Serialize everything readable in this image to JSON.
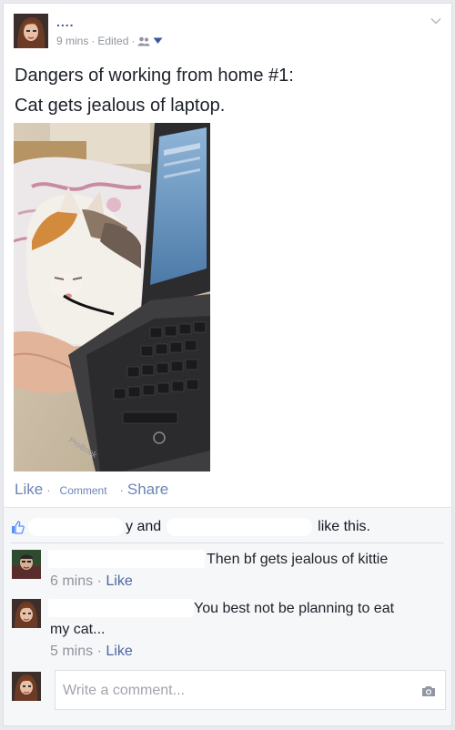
{
  "post": {
    "author": "....",
    "time": "9 mins",
    "sep1": "·",
    "edited": "Edited",
    "sep2": "·",
    "audience_icon": "friends-icon",
    "line1": "Dangers of working from home #1:",
    "line2": "Cat gets jealous of laptop.",
    "photo_icon": "cat-laptop-photo",
    "laptop_brand": "ProBook",
    "actions": {
      "like": "Like",
      "dot1": "·",
      "comment": "Comment",
      "dot2": "·",
      "share": "Share"
    }
  },
  "likes": {
    "and": "y and",
    "suffix": "like this."
  },
  "comments": [
    {
      "text": "Then bf gets jealous of kittie",
      "time": "6 mins",
      "sep": "·",
      "like": "Like"
    },
    {
      "text": "You best not be planning to eat",
      "text2": "my cat...",
      "time": "5 mins",
      "sep": "·",
      "like": "Like"
    }
  ],
  "composer": {
    "placeholder": "Write a comment...",
    "camera_icon": "camera-icon"
  },
  "colors": {
    "link": "#3b5998",
    "muted": "#90949c",
    "action": "#6d84b4",
    "panel": "#f6f7f9"
  }
}
